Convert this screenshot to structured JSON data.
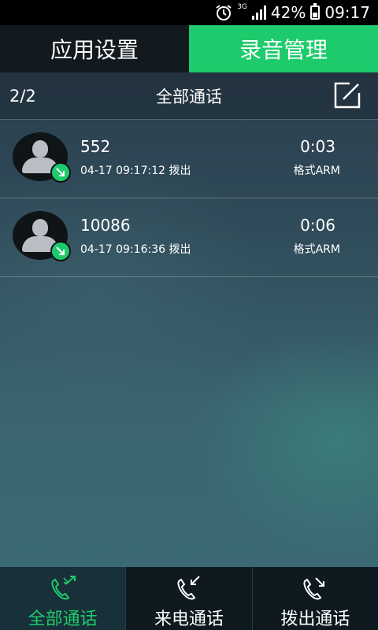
{
  "status_bar": {
    "network": "3G",
    "battery": "42%",
    "battery_level": 0.42,
    "time": "09:17"
  },
  "top_tabs": [
    {
      "label": "应用设置",
      "active": false
    },
    {
      "label": "录音管理",
      "active": true
    }
  ],
  "list_header": {
    "count": "2/2",
    "title": "全部通话"
  },
  "calls": [
    {
      "number": "552",
      "datetime": "04-17 09:17:12",
      "direction": "拨出",
      "duration": "0:03",
      "format": "格式ARM"
    },
    {
      "number": "10086",
      "datetime": "04-17 09:16:36",
      "direction": "拨出",
      "duration": "0:06",
      "format": "格式ARM"
    }
  ],
  "bottom_nav": [
    {
      "label": "全部通话",
      "icon": "all-calls-icon",
      "active": true
    },
    {
      "label": "来电通话",
      "icon": "incoming-call-icon",
      "active": false
    },
    {
      "label": "拨出通话",
      "icon": "outgoing-call-icon",
      "active": false
    }
  ],
  "colors": {
    "accent": "#1ecb6c",
    "tab_inactive": "#121a20",
    "status_bar": "#000000"
  }
}
